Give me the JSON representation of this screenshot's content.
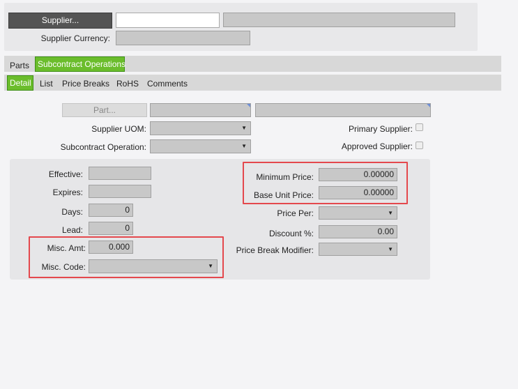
{
  "header": {
    "supplier_button": "Supplier...",
    "supplier_code": "",
    "supplier_name": "",
    "supplier_currency_label": "Supplier Currency:",
    "supplier_currency_value": ""
  },
  "tabs": {
    "primary": [
      {
        "label": "Parts",
        "active": false
      },
      {
        "label": "Subcontract Operations",
        "active": true
      }
    ],
    "secondary": [
      {
        "label": "Detail",
        "active": true
      },
      {
        "label": "List",
        "active": false
      },
      {
        "label": "Price Breaks",
        "active": false
      },
      {
        "label": "RoHS",
        "active": false
      },
      {
        "label": "Comments",
        "active": false
      }
    ]
  },
  "form": {
    "part_button": "Part...",
    "supplier_uom_label": "Supplier UOM:",
    "subcontract_operation_label": "Subcontract Operation:",
    "primary_supplier_label": "Primary Supplier:",
    "approved_supplier_label": "Approved Supplier:",
    "effective_label": "Effective:",
    "expires_label": "Expires:",
    "days_label": "Days:",
    "days_value": "0",
    "lead_label": "Lead:",
    "lead_value": "0",
    "misc_amt_label": "Misc. Amt:",
    "misc_amt_value": "0.000",
    "misc_code_label": "Misc. Code:",
    "minimum_price_label": "Minimum Price:",
    "minimum_price_value": "0.00000",
    "base_unit_price_label": "Base Unit Price:",
    "base_unit_price_value": "0.00000",
    "price_per_label": "Price Per:",
    "discount_label": "Discount %:",
    "discount_value": "0.00",
    "price_break_modifier_label": "Price Break Modifier:"
  },
  "icons": {
    "dropdown_arrow": "▼"
  },
  "colors": {
    "tab_active": "#6bbd2c",
    "highlight": "#e4484d",
    "supplier_button": "#545454"
  }
}
